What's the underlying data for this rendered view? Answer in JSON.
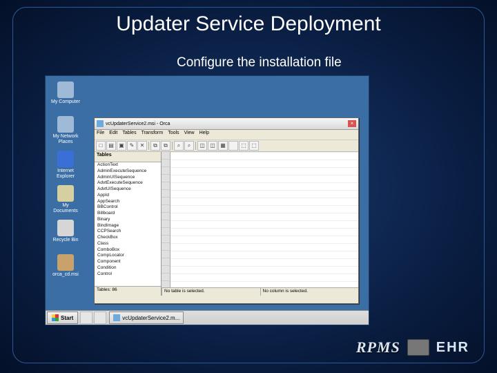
{
  "slide": {
    "title": "Updater Service Deployment",
    "subtitle": "Configure the installation file"
  },
  "desktop_icons": [
    {
      "label": "My Computer",
      "color": "#9fbad6"
    },
    {
      "label": "My Network Places",
      "color": "#9fbad6"
    },
    {
      "label": "Internet Explorer",
      "color": "#3a6fd8"
    },
    {
      "label": "My Documents",
      "color": "#d6cfa0"
    },
    {
      "label": "Recycle Bin",
      "color": "#d6d6d6"
    },
    {
      "label": "orca_cd.msi",
      "color": "#c8a26a"
    }
  ],
  "window": {
    "title": "vcUpdaterService2.msi - Orca",
    "menu": [
      "File",
      "Edit",
      "Tables",
      "Transform",
      "Tools",
      "View",
      "Help"
    ],
    "tables_header": "Tables",
    "tables": [
      "ActionText",
      "AdminExecuteSequence",
      "AdminUISequence",
      "AdvtExecuteSequence",
      "AdvtUISequence",
      "AppId",
      "AppSearch",
      "BBControl",
      "Billboard",
      "Binary",
      "BindImage",
      "CCPSearch",
      "CheckBox",
      "Class",
      "ComboBox",
      "CompLocator",
      "Component",
      "Condition",
      "Control"
    ],
    "table_count": "Tables: 86",
    "status_mid": "No table is selected.",
    "status_right": "No column is selected.",
    "toolbar_icons": [
      "□",
      "▤",
      "▣",
      "✎",
      "✕",
      "|",
      "⧉",
      "⧉",
      "|",
      "⌕",
      "⌕",
      "|",
      "◫",
      "◫",
      "▦",
      "",
      "⬚",
      "⬚"
    ]
  },
  "taskbar": {
    "start": "Start",
    "task_button": "vcUpdaterService2.m..."
  },
  "branding": {
    "rpms": "RPMS",
    "ehr": "EHR"
  }
}
